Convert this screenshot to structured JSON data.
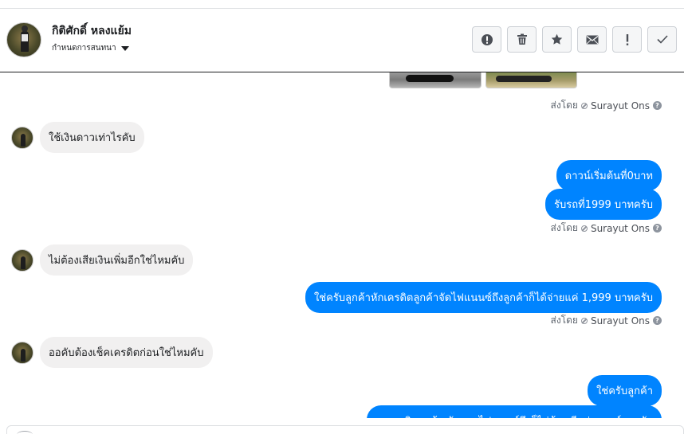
{
  "contact": {
    "name": "กิติศักดิ์ หลงแย้ม",
    "subtitle": "กำหนดการสนทนา"
  },
  "actions": [
    {
      "name": "report-icon"
    },
    {
      "name": "trash-icon"
    },
    {
      "name": "star-icon"
    },
    {
      "name": "envelope-icon"
    },
    {
      "name": "exclamation-icon"
    },
    {
      "name": "check-icon"
    }
  ],
  "sent_by": {
    "prefix": "ส่งโดย",
    "agent": "Surayut Ons"
  },
  "messages": {
    "in_1": "ใช้เงินดาวเท่าไรคับ",
    "out_1": "ดาวน์เริ่มต้นที่0บาท",
    "out_2": "รับรถที่1999 บาทครับ",
    "in_2": "ไม่ต้องเสียเงินเพิ่มอีกใช่ไหมคับ",
    "out_3": "ใช่ครับลูกค้าหักเครดิตลูกค้าจัดไฟแนนซ์ถึงลูกค้าก็ได้จ่ายแค่ 1,999 บาทครับ",
    "in_3": "ออคับต้องเช็คเครดิตก่อนใช่ไหมคับ",
    "out_4": "ใช่ครับลูกค้า",
    "out_5": "หาเครดิตลูกค้า ตัดยอดไฟแนนซ์ถึงก็ไม่ต้องเสียค่าดาวน์นะครับ"
  },
  "colors": {
    "outgoing_bubble": "#0084ff",
    "incoming_bubble": "#f1f0f0",
    "header_border": "#1c1e21"
  }
}
